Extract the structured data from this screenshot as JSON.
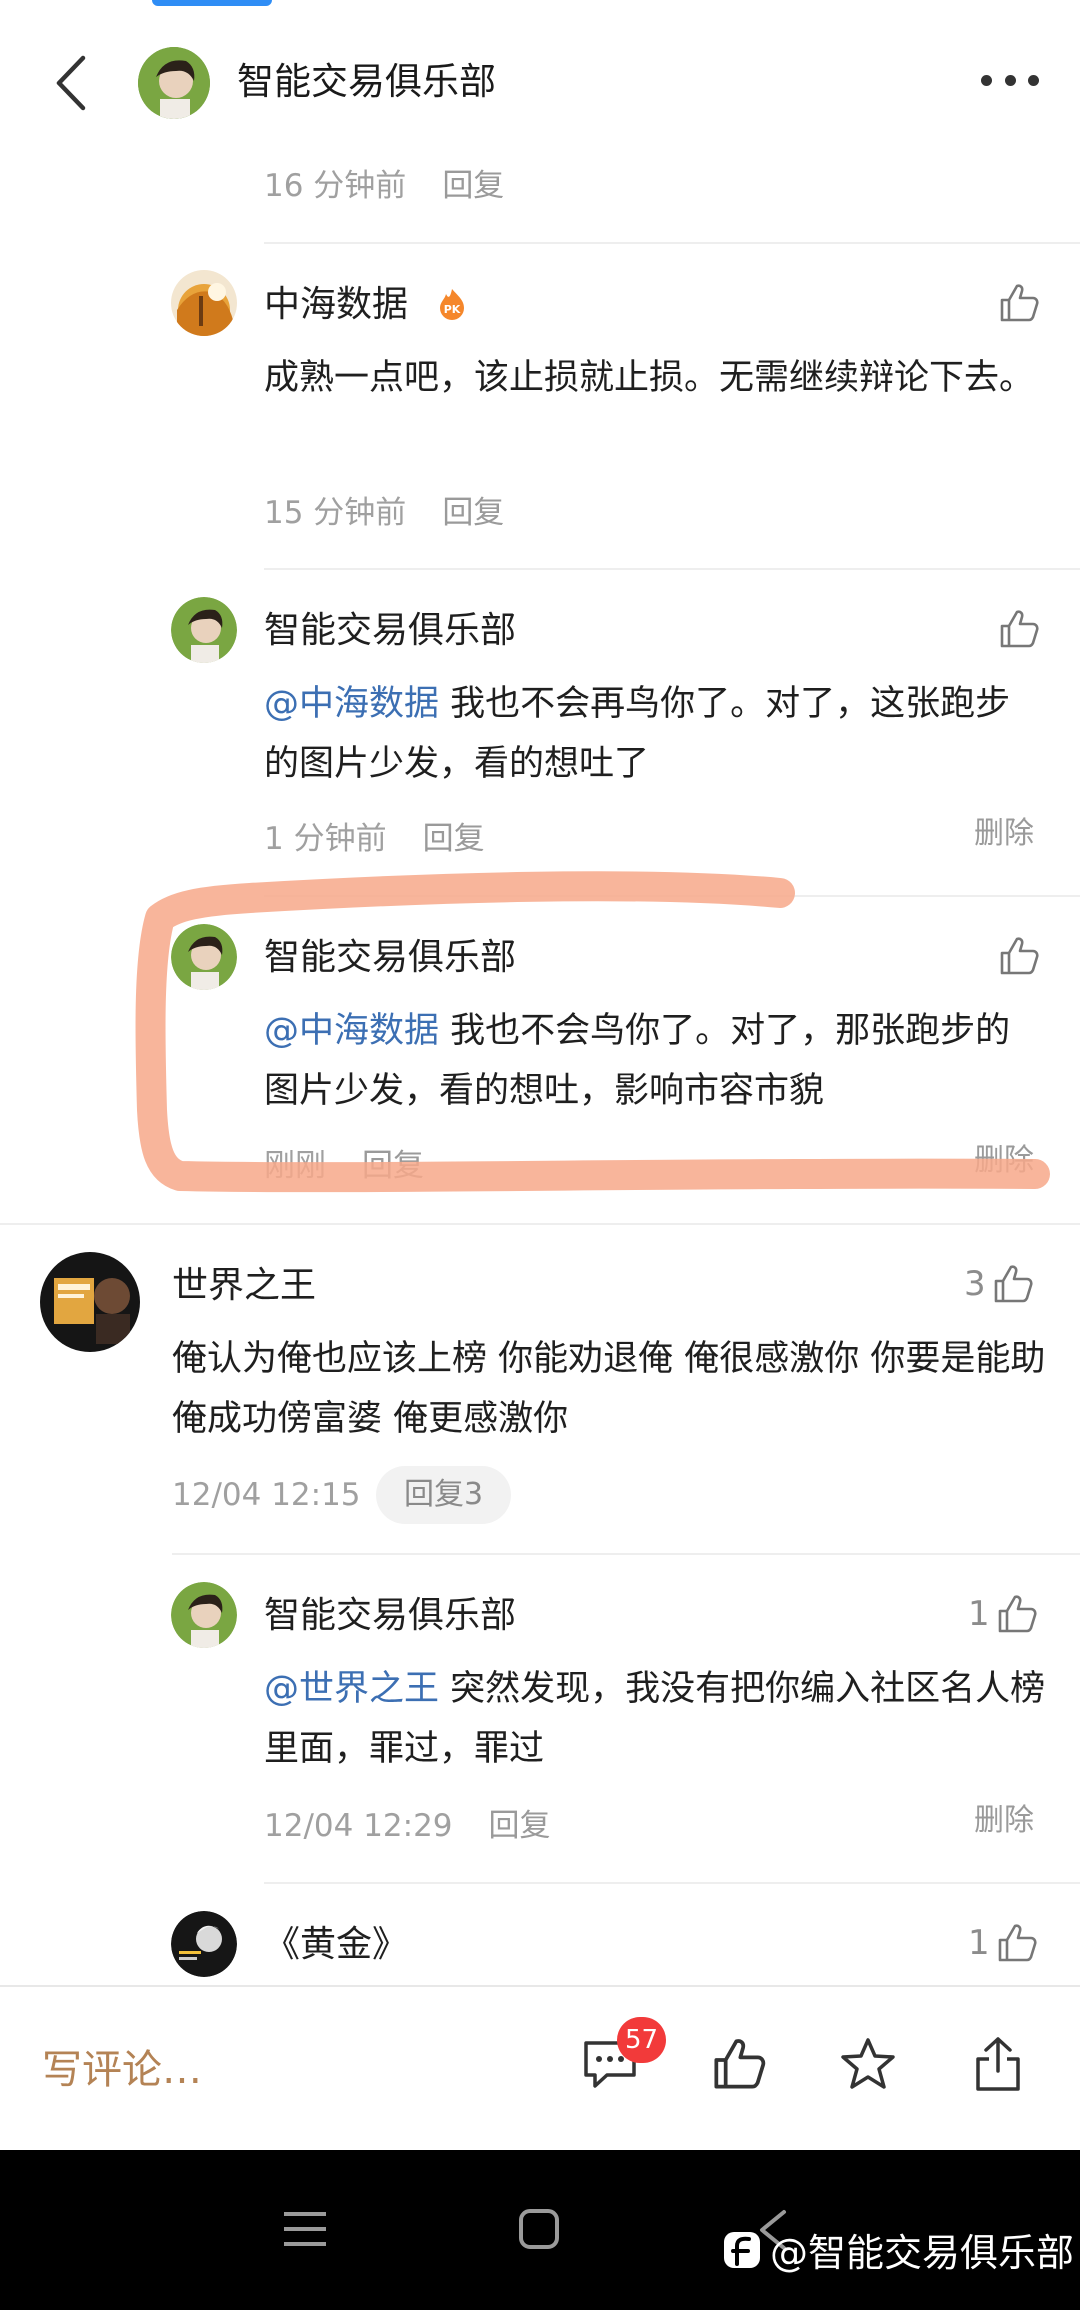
{
  "header": {
    "title": "智能交易俱乐部"
  },
  "comments": [
    {
      "meta_time": "16 分钟前",
      "meta_reply": "回复"
    },
    {
      "user": "中海数据",
      "text": "成熟一点吧，该止损就止损。无需继续辩论下去。",
      "meta_time": "15 分钟前",
      "meta_reply": "回复",
      "badge_text": "PK"
    },
    {
      "user": "智能交易俱乐部",
      "mention": "@中海数据",
      "text": " 我也不会再鸟你了。对了，这张跑步的图片少发，看的想吐了",
      "meta_time": "1 分钟前",
      "meta_reply": "回复",
      "delete": "删除"
    },
    {
      "user": "智能交易俱乐部",
      "mention": "@中海数据",
      "text": " 我也不会鸟你了。对了，那张跑步的图片少发，看的想吐，影响市容市貌",
      "meta_time": "刚刚",
      "meta_reply": "回复",
      "delete": "删除"
    },
    {
      "user": "世界之王",
      "text": "俺认为俺也应该上榜 你能劝退俺 俺很感激你 你要是能助俺成功傍富婆 俺更感激你",
      "meta_time": "12/04 12:15",
      "reply_pill": "回复3",
      "likes": "3"
    },
    {
      "user": "智能交易俱乐部",
      "mention": "@世界之王",
      "text": " 突然发现，我没有把你编入社区名人榜里面，罪过，罪过",
      "meta_time": "12/04 12:29",
      "meta_reply": "回复",
      "likes": "1",
      "delete": "删除"
    },
    {
      "user": "《黄金》",
      "likes": "1"
    }
  ],
  "bottom_bar": {
    "write_placeholder": "写评论…",
    "comment_count": "57"
  },
  "watermark": "@智能交易俱乐部",
  "colors": {
    "mention": "#3c6fb3",
    "badge": "#f23a3a",
    "write_comment": "#b48355",
    "highlight_stroke": "#f7a889"
  }
}
